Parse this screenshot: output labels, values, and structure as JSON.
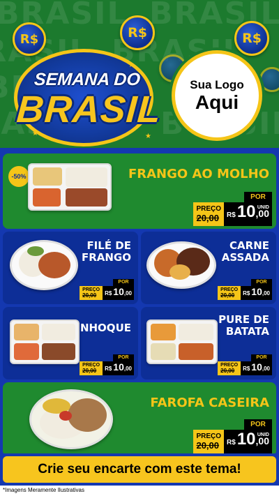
{
  "header": {
    "background_word": "BRASIL",
    "coin_label": "R$",
    "title_line1": "SEMANA DO",
    "title_line2": "BRASIL",
    "logo_line1": "Sua Logo",
    "logo_line2": "Aqui"
  },
  "products": [
    {
      "name": "FRANGO AO MOLHO",
      "discount": "-50%",
      "price_label": "PREÇO",
      "old_price": "20,00",
      "por": "POR",
      "currency": "R$",
      "price_int": "10",
      "price_dec": ",00",
      "unit": "UNID"
    },
    {
      "name_l1": "FILÉ DE",
      "name_l2": "FRANGO",
      "price_label": "PREÇO",
      "old_price": "20,00",
      "por": "POR",
      "currency": "R$",
      "price_int": "10",
      "price_dec": ",00"
    },
    {
      "name_l1": "CARNE",
      "name_l2": "ASSADA",
      "price_label": "PREÇO",
      "old_price": "20,00",
      "por": "POR",
      "currency": "R$",
      "price_int": "10",
      "price_dec": ",00"
    },
    {
      "name": "NHOQUE",
      "price_label": "PREÇO",
      "old_price": "20,00",
      "por": "POR",
      "currency": "R$",
      "price_int": "10",
      "price_dec": ",00"
    },
    {
      "name_l1": "PURE DE",
      "name_l2": "BATATA",
      "price_label": "PREÇO",
      "old_price": "20,00",
      "por": "POR",
      "currency": "R$",
      "price_int": "10",
      "price_dec": ",00"
    },
    {
      "name": "FAROFA CASEIRA",
      "price_label": "PREÇO",
      "old_price": "20,00",
      "por": "POR",
      "currency": "R$",
      "price_int": "10",
      "price_dec": ",00",
      "unit": "UNID"
    }
  ],
  "cta": "Crie seu encarte com este tema!",
  "disclaimer": "*Imagens Meramente Ilustrativas",
  "colors": {
    "green": "#1f8a2f",
    "blue": "#1438b0",
    "yellow": "#f5c518",
    "dark_blue": "#0d2e97"
  }
}
